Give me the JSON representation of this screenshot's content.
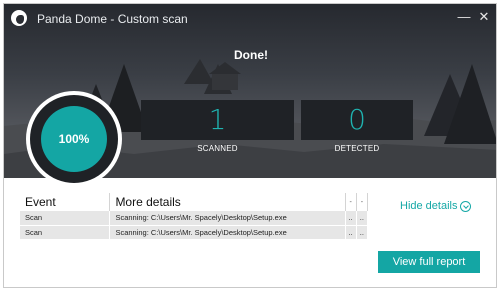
{
  "window": {
    "title": "Panda Dome - Custom scan",
    "minimize_glyph": "—",
    "close_glyph": "✕"
  },
  "scan": {
    "status": "Done!",
    "progress_percent": 100,
    "progress_label": "100%",
    "scanned_count": "1",
    "scanned_label": "SCANNED",
    "detected_count": "0",
    "detected_label": "DETECTED"
  },
  "table": {
    "columns": [
      "Event",
      "More details",
      "-",
      "-"
    ],
    "rows": [
      [
        "Scan",
        "Scanning: C:\\Users\\Mr. Spacely\\Desktop\\Setup.exe",
        "..",
        ".."
      ],
      [
        "Scan",
        "Scanning: C:\\Users\\Mr. Spacely\\Desktop\\Setup.exe",
        "..",
        ".."
      ]
    ]
  },
  "actions": {
    "hide_details": "Hide details",
    "view_report": "View full report"
  },
  "colors": {
    "accent": "#14a6a4",
    "dark_panel": "#1f2226"
  }
}
